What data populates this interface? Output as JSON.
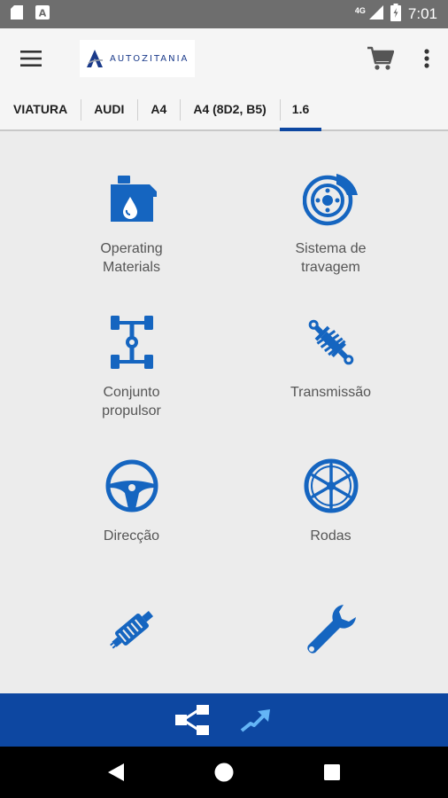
{
  "status_bar": {
    "time": "7:01",
    "network": "4G"
  },
  "app_bar": {
    "logo_text": "AUTOZITANIA"
  },
  "breadcrumb": [
    {
      "label": "VIATURA"
    },
    {
      "label": "AUDI"
    },
    {
      "label": "A4"
    },
    {
      "label": "A4 (8D2, B5)"
    },
    {
      "label": "1.6",
      "active": true
    }
  ],
  "categories": [
    {
      "label": "Operating\nMaterials",
      "icon": "oil-can-icon"
    },
    {
      "label": "Sistema de\ntravagem",
      "icon": "brake-disc-icon"
    },
    {
      "label": "Conjunto\npropulsor",
      "icon": "drivetrain-icon"
    },
    {
      "label": "Transmissão",
      "icon": "shock-absorber-icon"
    },
    {
      "label": "Direcção",
      "icon": "steering-wheel-icon"
    },
    {
      "label": "Rodas",
      "icon": "wheel-icon"
    },
    {
      "label": "",
      "icon": "exhaust-icon"
    },
    {
      "label": "",
      "icon": "wrench-icon"
    }
  ],
  "colors": {
    "accent": "#0d47a1",
    "icon": "#1565c0",
    "status_bar": "#6e6e6e"
  }
}
